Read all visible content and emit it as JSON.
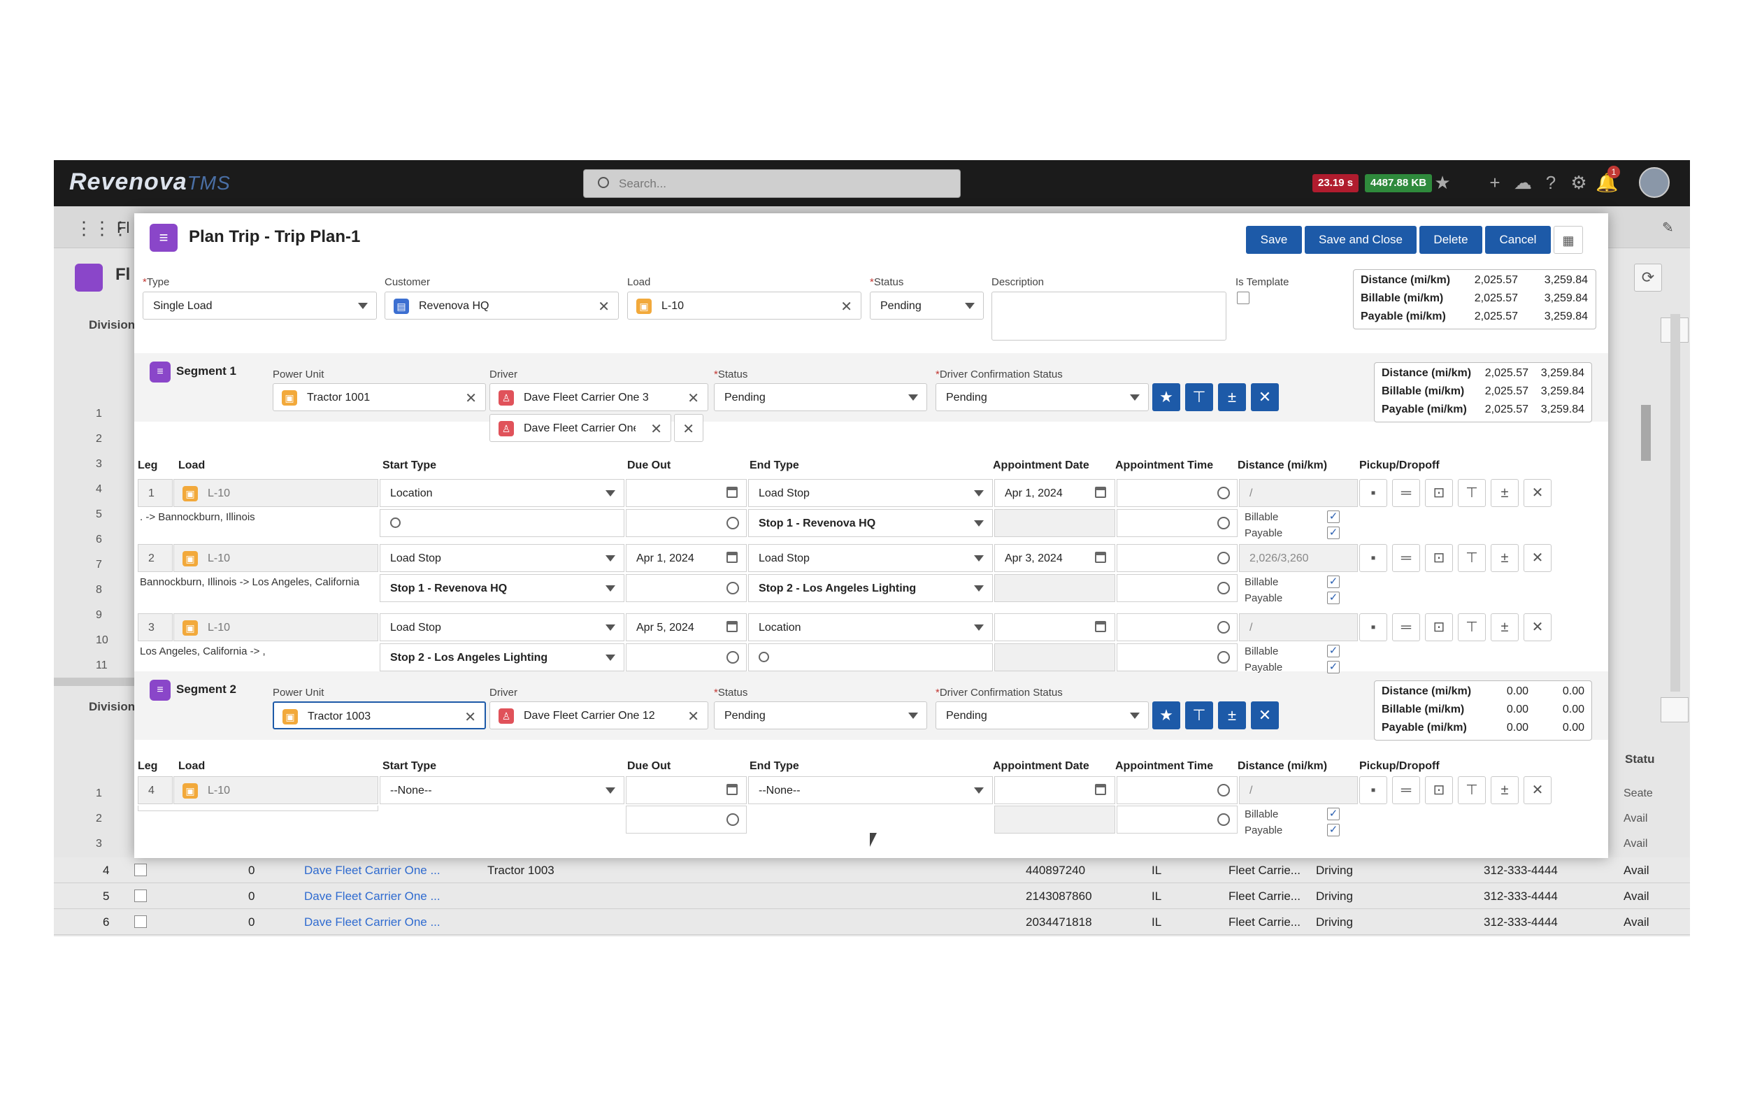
{
  "app": {
    "logo_main": "Revenova",
    "logo_tms": "TMS",
    "search_placeholder": "Search...",
    "perf_time": "23.19 s",
    "perf_mem": "4487.88 KB",
    "subbar_text": "Fl",
    "page_badge_text": "Fl",
    "background_label_division": "Division",
    "background_label_division2": "Division",
    "background_status_header": "Statu",
    "bg_row_numbers": [
      "1",
      "2",
      "3",
      "4",
      "5",
      "6",
      "7",
      "8",
      "9",
      "10",
      "11"
    ],
    "bg_row_numbers2": [
      "1",
      "2",
      "3"
    ],
    "bg_status_values": [
      "Seate",
      "Avail",
      "Avail"
    ],
    "bg_rows": [
      {
        "num": "4",
        "count": "0",
        "driver": "Dave Fleet Carrier One ...",
        "unit": "Tractor 1003",
        "id": "440897240",
        "state": "IL",
        "carrier": "Fleet Carrie...",
        "mode": "Driving",
        "phone": "312-333-4444",
        "status": "Avail"
      },
      {
        "num": "5",
        "count": "0",
        "driver": "Dave Fleet Carrier One ...",
        "unit": "",
        "id": "2143087860",
        "state": "IL",
        "carrier": "Fleet Carrie...",
        "mode": "Driving",
        "phone": "312-333-4444",
        "status": "Avail"
      },
      {
        "num": "6",
        "count": "0",
        "driver": "Dave Fleet Carrier One ...",
        "unit": "",
        "id": "2034471818",
        "state": "IL",
        "carrier": "Fleet Carrie...",
        "mode": "Driving",
        "phone": "312-333-4444",
        "status": "Avail"
      }
    ],
    "notification_count": "1"
  },
  "modal": {
    "title": "Plan Trip - Trip Plan-1",
    "buttons": {
      "save": "Save",
      "save_close": "Save and Close",
      "delete": "Delete",
      "cancel": "Cancel"
    },
    "type_label": "Type",
    "type_value": "Single Load",
    "customer_label": "Customer",
    "customer_value": "Revenova HQ",
    "load_label": "Load",
    "load_value": "L-10",
    "status_label": "Status",
    "status_value": "Pending",
    "description_label": "Description",
    "is_template_label": "Is Template",
    "summary": [
      {
        "label": "Distance (mi/km)",
        "mi": "2,025.57",
        "km": "3,259.84"
      },
      {
        "label": "Billable (mi/km)",
        "mi": "2,025.57",
        "km": "3,259.84"
      },
      {
        "label": "Payable (mi/km)",
        "mi": "2,025.57",
        "km": "3,259.84"
      }
    ]
  },
  "labels": {
    "power_unit": "Power Unit",
    "driver": "Driver",
    "status": "Status",
    "driver_conf": "Driver Confirmation Status",
    "leg": "Leg",
    "load": "Load",
    "start_type": "Start Type",
    "due_out": "Due Out",
    "end_type": "End Type",
    "appt_date": "Appointment Date",
    "appt_time": "Appointment Time",
    "distance": "Distance (mi/km)",
    "pickup": "Pickup/Dropoff",
    "billable": "Billable",
    "payable": "Payable"
  },
  "segment1": {
    "name": "Segment 1",
    "power_unit": "Tractor 1001",
    "driver1": "Dave Fleet Carrier One 3",
    "driver2": "Dave Fleet Carrier One",
    "status": "Pending",
    "conf_status": "Pending",
    "summary": [
      {
        "label": "Distance (mi/km)",
        "mi": "2,025.57",
        "km": "3,259.84"
      },
      {
        "label": "Billable (mi/km)",
        "mi": "2,025.57",
        "km": "3,259.84"
      },
      {
        "label": "Payable (mi/km)",
        "mi": "2,025.57",
        "km": "3,259.84"
      }
    ],
    "legs": [
      {
        "num": "1",
        "load": "L-10",
        "route": ". -> Bannockburn, Illinois",
        "start_type": "Location",
        "start_sub": "",
        "due_out": "",
        "end_type": "Load Stop",
        "end_sub": "Stop 1 - Revenova HQ",
        "appt_date": "Apr 1, 2024",
        "distance": "/"
      },
      {
        "num": "2",
        "load": "L-10",
        "route": "Bannockburn, Illinois -> Los Angeles, California",
        "start_type": "Load Stop",
        "start_sub": "Stop 1 - Revenova HQ",
        "due_out": "Apr 1, 2024",
        "end_type": "Load Stop",
        "end_sub": "Stop 2 - Los Angeles Lighting",
        "appt_date": "Apr 3, 2024",
        "distance": "2,026/3,260"
      },
      {
        "num": "3",
        "load": "L-10",
        "route": "Los Angeles, California -> ,",
        "start_type": "Load Stop",
        "start_sub": "Stop 2 - Los Angeles Lighting",
        "due_out": "Apr 5, 2024",
        "end_type": "Location",
        "end_sub": "",
        "appt_date": "",
        "distance": "/"
      }
    ]
  },
  "segment2": {
    "name": "Segment 2",
    "power_unit": "Tractor 1003",
    "driver1": "Dave Fleet Carrier One 12",
    "status": "Pending",
    "conf_status": "Pending",
    "summary": [
      {
        "label": "Distance (mi/km)",
        "mi": "0.00",
        "km": "0.00"
      },
      {
        "label": "Billable (mi/km)",
        "mi": "0.00",
        "km": "0.00"
      },
      {
        "label": "Payable (mi/km)",
        "mi": "0.00",
        "km": "0.00"
      }
    ],
    "legs": [
      {
        "num": "4",
        "load": "L-10",
        "start_type": "--None--",
        "end_type": "--None--",
        "distance": "/"
      }
    ]
  }
}
